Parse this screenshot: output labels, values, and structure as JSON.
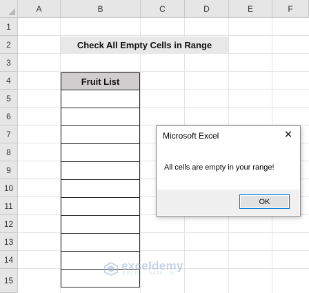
{
  "spreadsheet": {
    "columns": [
      "A",
      "B",
      "C",
      "D",
      "E",
      "F"
    ],
    "rows": [
      "1",
      "2",
      "3",
      "4",
      "5",
      "6",
      "7",
      "8",
      "9",
      "10",
      "11",
      "12",
      "13",
      "14",
      "15"
    ],
    "title": "Check All Empty Cells in Range",
    "table_header": "Fruit List",
    "table_cells": [
      "",
      "",
      "",
      "",
      "",
      "",
      "",
      "",
      "",
      "",
      ""
    ]
  },
  "dialog": {
    "title": "Microsoft Excel",
    "close_icon": "close-icon",
    "message": "All cells are empty in your range!",
    "ok_label": "OK"
  },
  "watermark": {
    "name": "exceldemy",
    "tagline": "EXCEL · DATA · BI",
    "colors": {
      "accent": "#9bb4d6"
    }
  },
  "colors": {
    "header_bg": "#e6e6e6",
    "title_bg": "#e8e8e8",
    "table_header_bg": "#d0cece",
    "dialog_button_border": "#0078d7"
  }
}
